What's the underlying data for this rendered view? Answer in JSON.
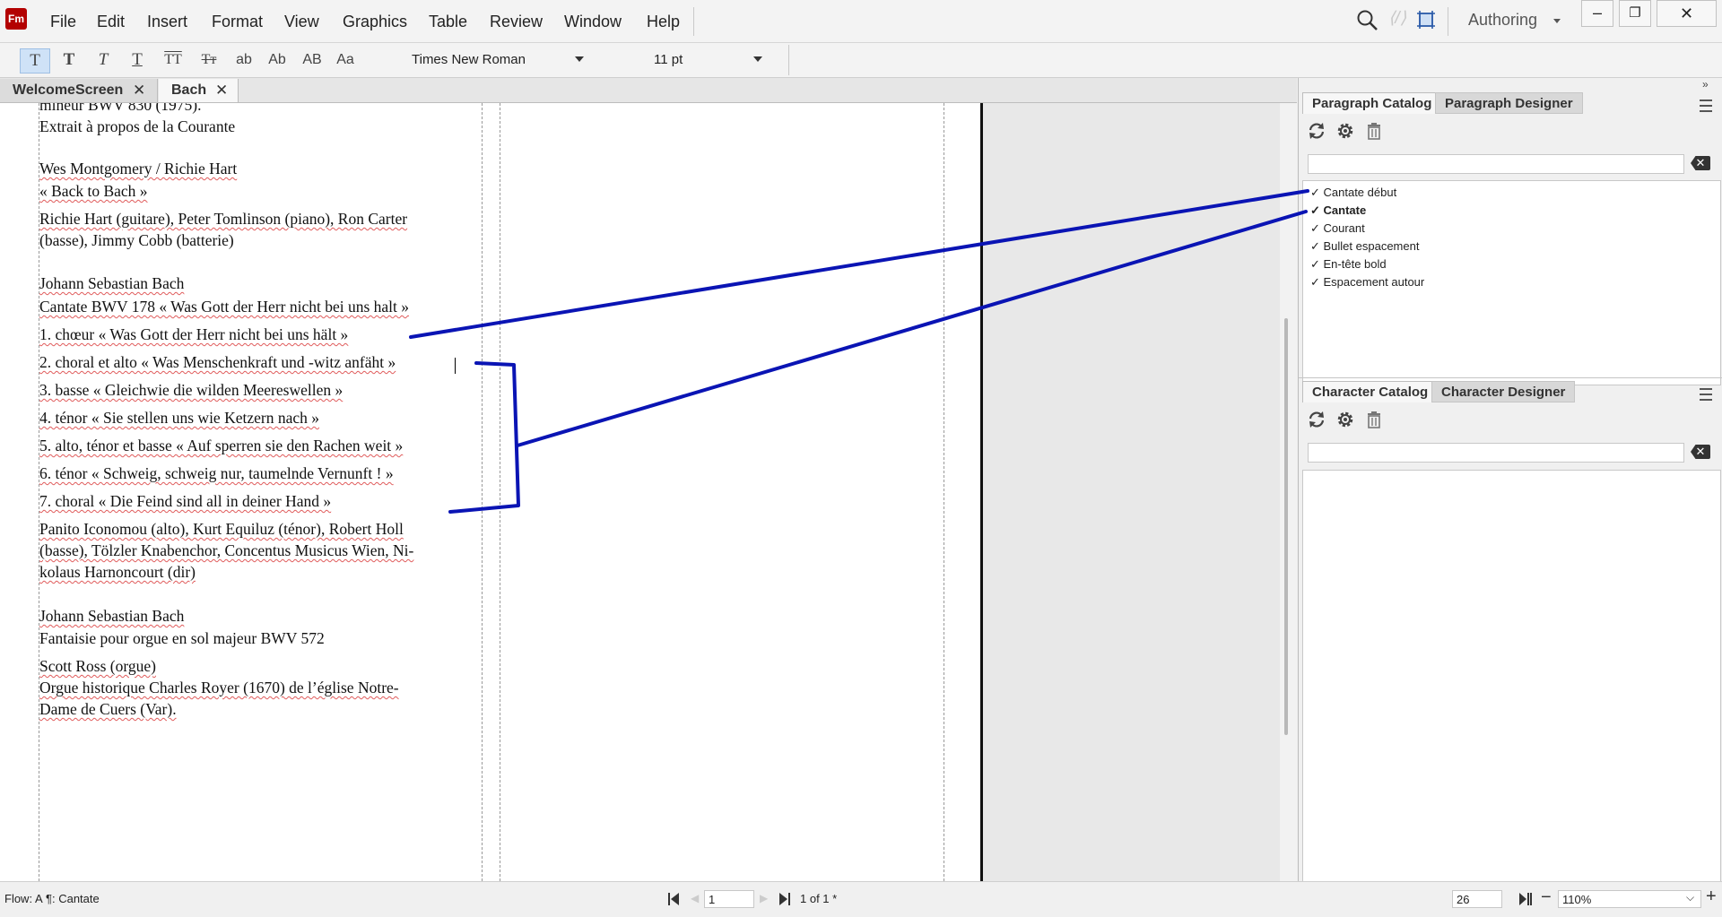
{
  "app": {
    "logo_text": "Fm",
    "workspace": "Authoring"
  },
  "menu": [
    "File",
    "Edit",
    "Insert",
    "Format",
    "View",
    "Graphics",
    "Table",
    "Review",
    "Window",
    "Help"
  ],
  "window_controls": {
    "minimize": "–",
    "restore": "❐",
    "close": "✕"
  },
  "toolbar": {
    "style_buttons": [
      "T",
      "T",
      "T",
      "T",
      "TT",
      "Tт",
      "ab",
      "Ab",
      "AB",
      "Aa"
    ],
    "font_family": "Times New Roman",
    "font_size": "11 pt"
  },
  "tabs": [
    {
      "label": "WelcomeScreen",
      "close": "✕"
    },
    {
      "label": "Bach",
      "close": "✕"
    }
  ],
  "document_lines": [
    "mineur BWV 830 (1975).",
    "Extrait à propos de la Courante",
    "Wes Montgomery / Richie Hart",
    "« Back to Bach »",
    "Richie Hart (guitare), Peter Tomlinson (piano), Ron Carter",
    "(basse), Jimmy Cobb (batterie)",
    "Johann Sebastian Bach",
    "Cantate BWV 178 « Was Gott der Herr nicht bei uns halt »",
    "1. chœur « Was Gott der Herr nicht bei uns hält »",
    "2. choral et alto « Was Menschenkraft und -witz anfäht »",
    "3. basse « Gleichwie die wilden Meereswellen »",
    "4. ténor « Sie stellen uns wie Ketzern nach »",
    "5. alto, ténor et basse « Auf sperren sie den Rachen weit »",
    "6. ténor « Schweig, schweig nur, taumelnde Vernunft ! »",
    "7. choral « Die Feind sind all in deiner Hand »",
    "Panito Iconomou (alto), Kurt Equiluz (ténor), Robert Holl",
    "(basse), Tölzler Knabenchor, Concentus Musicus Wien, Ni-",
    "kolaus Harnoncourt (dir)",
    "Johann Sebastian Bach",
    "Fantaisie pour orgue en sol majeur BWV 572",
    "Scott Ross (orgue)",
    "Orgue historique Charles Royer (1670) de l’église Notre-",
    "Dame de Cuers (Var)."
  ],
  "paragraph_panel": {
    "tabs": [
      "Paragraph Catalog",
      "Paragraph Designer"
    ],
    "items": [
      {
        "label": "✓ Cantate début",
        "bold": false
      },
      {
        "label": "✓ Cantate",
        "bold": true
      },
      {
        "label": "✓ Courant",
        "bold": false
      },
      {
        "label": "✓ Bullet espacement",
        "bold": false
      },
      {
        "label": "✓ En-tête bold",
        "bold": false
      },
      {
        "label": "✓ Espacement autour",
        "bold": false
      }
    ]
  },
  "character_panel": {
    "tabs": [
      "Character Catalog",
      "Character Designer"
    ]
  },
  "panel_icons": [
    "refresh-icon",
    "gear-icon",
    "trash-icon"
  ],
  "status": {
    "flow": "Flow: A",
    "paragraph_tag": "¶: Cantate",
    "page_input": "1",
    "page_count": "1 of 1 *",
    "view_value": "26",
    "zoom": "110%"
  },
  "colors": {
    "annotation": "#0a14b4",
    "active_tool": "#cfe2f7"
  }
}
